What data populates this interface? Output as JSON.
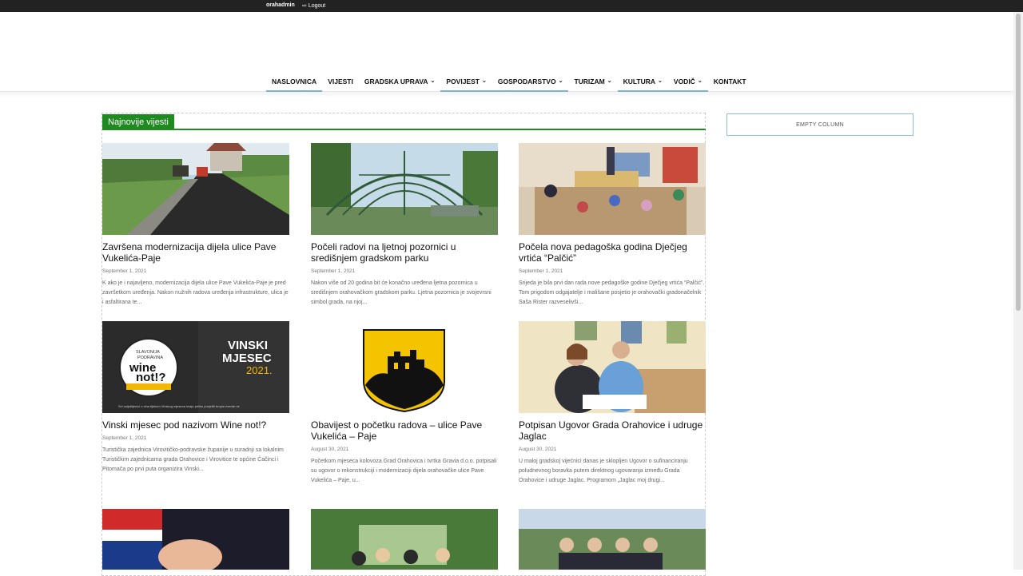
{
  "adminbar": {
    "user": "orahadmin",
    "logout": "Logout"
  },
  "nav": [
    {
      "label": "NASLOVNICA",
      "dropdown": false,
      "active": true
    },
    {
      "label": "VIJESTI",
      "dropdown": false,
      "active": false
    },
    {
      "label": "GRADSKA UPRAVA",
      "dropdown": true,
      "active": false
    },
    {
      "label": "POVIJEST",
      "dropdown": true,
      "active": true
    },
    {
      "label": "GOSPODARSTVO",
      "dropdown": true,
      "active": true
    },
    {
      "label": "TURIZAM",
      "dropdown": true,
      "active": false
    },
    {
      "label": "KULTURA",
      "dropdown": true,
      "active": true
    },
    {
      "label": "VODIČ",
      "dropdown": true,
      "active": true
    },
    {
      "label": "KONTAKT",
      "dropdown": false,
      "active": false
    }
  ],
  "block_title": "Najnovije vijesti",
  "sidebar": {
    "empty_label": "EMPTY COLUMN"
  },
  "posts": [
    {
      "title": "Završena modernizacija dijela ulice Pave Vukelića-Paje",
      "date": "September 1, 2021",
      "excerpt": "K ako je i najavljeno, modernizacija dijela ulice Pave Vukelića-Paje je pred završetkom uređenja. Nakon nužnih radova uređenja infrastrukture, ulica je i asfaltirana te..."
    },
    {
      "title": "Počeli radovi na ljetnoj pozornici u središnjem gradskom parku",
      "date": "September 1, 2021",
      "excerpt": "Nakon više od 20 godina bit će konačno uređena ljetna pozornica u središnjem orahovačkom gradskom parku. Ljetna pozornica je svojevrsni simbol grada, na njoj..."
    },
    {
      "title": "Počela nova pedagoška godina Dječjeg vrtića “Palčić”",
      "date": "September 1, 2021",
      "excerpt": "Srijeda je bila prvi dan rada nove pedagoške godine Dječjeg vrtića “Palčić”. Tom prigodom odgajatelje i mališane posjetio je orahovački gradonačelnik Saša Rister razveselivši..."
    },
    {
      "title": "Vinski mjesec pod nazivom Wine not!?",
      "date": "September 1, 2021",
      "excerpt": "Turistička zajednica Virovitičko-podravske županije u suradnji sa lokalnim Turističkim zajednicama grada Orahovice i Virovitice te općine Čačinci i Pitomača po prvi puta organizira Vinski..."
    },
    {
      "title": "Obavijest o početku radova – ulice Pave Vukelića – Paje",
      "date": "August 30, 2021",
      "excerpt": "Početkom mjeseca kolovoza Grad Orahovica i tvrtka Gravia d.o.o. potpisali su ugovor o rekonstrukciji i modernizaciji dijela orahovačke ulice Pave Vukelića – Paje, u..."
    },
    {
      "title": "Potpisan Ugovor Grada Orahovice i udruge Jaglac",
      "date": "August 30, 2021",
      "excerpt": "U maloj gradskoj vijećnici danas je sklopljen Ugovor o sufinanciranju poludnevnog boravka putem direktnog ugovaranja između Grada Orahovice i udruge Jaglac. Programom „Jaglac moj drugi..."
    }
  ],
  "vinski": {
    "line1": "VINSKI",
    "line2": "MJESEC",
    "line3": "2021.",
    "badge_top": "SLAVONIJA",
    "badge_sub": "PODRAVINA",
    "badge_main1": "wine",
    "badge_main2": "not!?",
    "footer": "Svi zaljubljenici u vina tijekom Vinskog mjeseca imaju priliku posjetiti brojne evente ne"
  }
}
